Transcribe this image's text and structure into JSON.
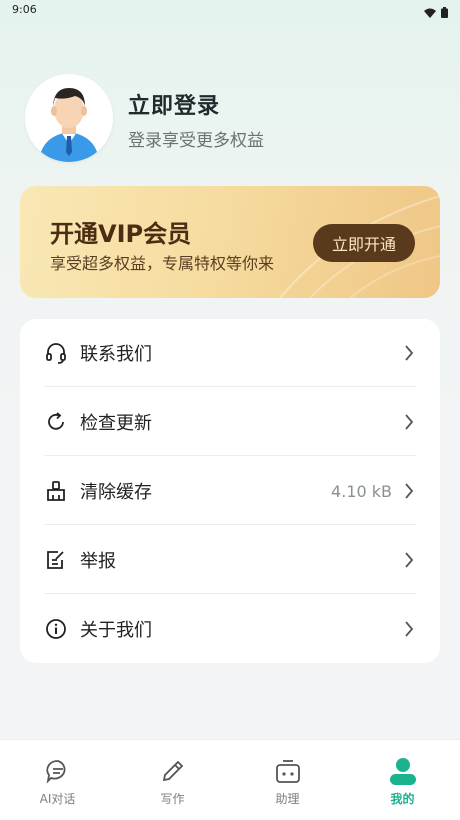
{
  "status_bar": {
    "time": "9:06",
    "icons": [
      "wifi-icon",
      "battery-icon"
    ]
  },
  "profile": {
    "title": "立即登录",
    "subtitle": "登录享受更多权益"
  },
  "vip": {
    "title": "开通VIP会员",
    "subtitle": "享受超多权益，专属特权等你来",
    "button": "立即开通"
  },
  "menu": {
    "items": [
      {
        "icon": "headset-icon",
        "label": "联系我们",
        "value": ""
      },
      {
        "icon": "refresh-icon",
        "label": "检查更新",
        "value": ""
      },
      {
        "icon": "broom-icon",
        "label": "清除缓存",
        "value": "4.10 kB"
      },
      {
        "icon": "report-edit-icon",
        "label": "举报",
        "value": ""
      },
      {
        "icon": "info-icon",
        "label": "关于我们",
        "value": ""
      }
    ]
  },
  "bottom_nav": {
    "items": [
      {
        "icon": "chat-bubble-icon",
        "label": "AI对话",
        "active": false
      },
      {
        "icon": "pencil-icon",
        "label": "写作",
        "active": false
      },
      {
        "icon": "robot-icon",
        "label": "助理",
        "active": false
      },
      {
        "icon": "user-icon",
        "label": "我的",
        "active": true
      }
    ]
  },
  "colors": {
    "accent": "#1bb28e",
    "vip_button": "#5a3a1c",
    "vip_card": "#f6dca0"
  }
}
